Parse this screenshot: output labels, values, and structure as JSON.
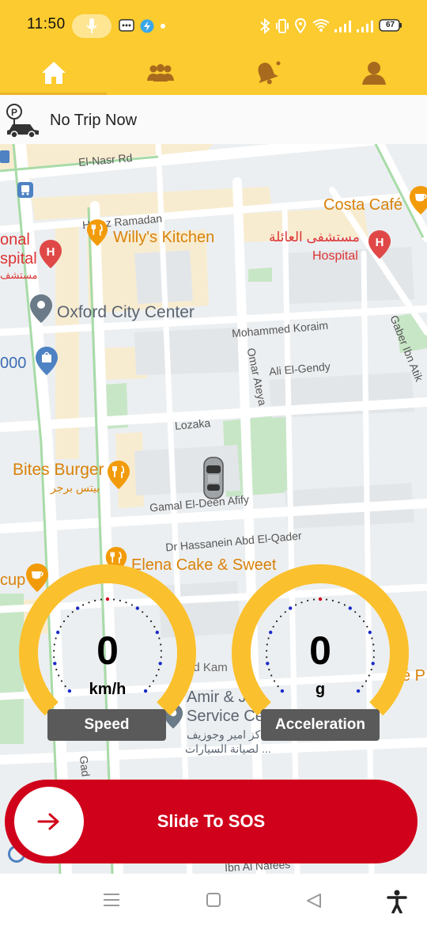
{
  "status_bar": {
    "time": "11:50",
    "battery": "67",
    "icons": [
      "mic-icon",
      "message-icon",
      "shield-bolt-icon",
      "dot-icon",
      "bluetooth-icon",
      "vibrate-icon",
      "location-icon",
      "wifi-icon",
      "signal-icon",
      "signal-icon",
      "battery-icon"
    ]
  },
  "nav": {
    "items": [
      {
        "name": "home",
        "icon": "home-icon",
        "active": true
      },
      {
        "name": "groups",
        "icon": "group-icon",
        "active": false
      },
      {
        "name": "notifications",
        "icon": "bell-icon",
        "active": false
      },
      {
        "name": "profile",
        "icon": "person-icon",
        "active": false
      }
    ]
  },
  "trip": {
    "status": "No Trip Now",
    "icon": "parking-car-icon"
  },
  "map": {
    "pois": {
      "costa": "Costa Café",
      "hospital_ar": "مستشفى العائلة",
      "hospital": "Hospital",
      "onal": "onal",
      "spital": "spital",
      "mustash": "مستشف",
      "willys": "Willy's Kitchen",
      "oxford": "Oxford City Center",
      "ooo": "000",
      "bites": "Bites Burger",
      "bites_ar": "بيتس برجر",
      "elena": "Elena Cake & Sweet",
      "cup": "cup",
      "amir": "Amir & J",
      "service": "Service Ce",
      "amir_ar1": "كز امير وجوزيف",
      "amir_ar2": "لصيانة السيارات ...",
      "kam": "ed Kam",
      "e_p": "é P"
    },
    "streets": {
      "elnasr": "El-Nasr Rd",
      "hafez": "Hafez Ramadan",
      "koraim": "Mohammed Koraim",
      "omar": "Omar Ateya",
      "gendy": "Ali El-Gendy",
      "gaber": "Gaber Ibn Atik",
      "lozaka": "Lozaka",
      "gamal": "Gamal El-Deen Afify",
      "hassanein": "Dr Hassanein Abd El-Qader",
      "gad": "Gad",
      "ibn": "Ibn Al Nafees"
    }
  },
  "gauges": {
    "speed": {
      "value": "0",
      "unit": "km/h",
      "label": "Speed"
    },
    "acceleration": {
      "value": "0",
      "unit": "g",
      "label": "Acceleration"
    }
  },
  "sos": {
    "label": "Slide To SOS",
    "icon": "arrow-right-icon"
  },
  "system_nav": [
    "menu-icon",
    "home-square-icon",
    "back-icon",
    "accessibility-icon"
  ],
  "colors": {
    "primary": "#fbcb2f",
    "gauge": "#fbc02d",
    "sos": "#d0021b",
    "poi_orange": "#f29b0a",
    "poi_red": "#e04848",
    "poi_blue": "#4e82c3"
  }
}
